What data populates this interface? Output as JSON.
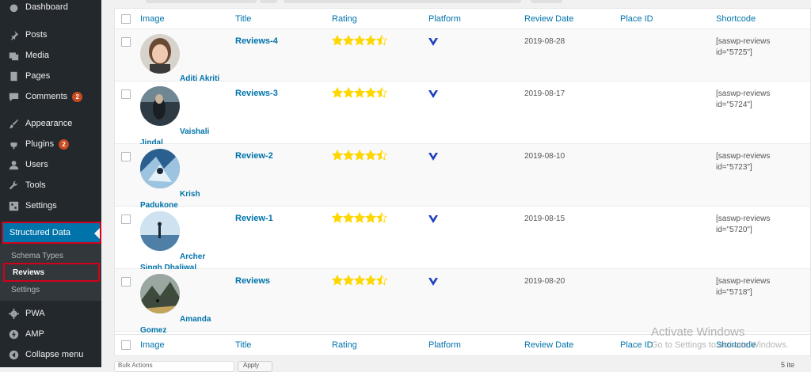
{
  "sidebar": {
    "items": [
      {
        "label": "Dashboard",
        "icon": "dashboard-icon"
      },
      {
        "label": "Posts",
        "icon": "pin-icon"
      },
      {
        "label": "Media",
        "icon": "media-icon"
      },
      {
        "label": "Pages",
        "icon": "pages-icon"
      },
      {
        "label": "Comments",
        "icon": "comment-icon",
        "badge": "2"
      },
      {
        "label": "Appearance",
        "icon": "brush-icon"
      },
      {
        "label": "Plugins",
        "icon": "plug-icon",
        "badge": "2"
      },
      {
        "label": "Users",
        "icon": "user-icon"
      },
      {
        "label": "Tools",
        "icon": "wrench-icon"
      },
      {
        "label": "Settings",
        "icon": "settings-icon"
      }
    ],
    "active": {
      "label": "Structured Data",
      "icon": "pin-icon"
    },
    "submenu": [
      "Schema Types",
      "Reviews",
      "Settings"
    ],
    "lower": [
      {
        "label": "PWA",
        "icon": "gear-icon"
      },
      {
        "label": "AMP",
        "icon": "amp-icon"
      },
      {
        "label": "Collapse menu",
        "icon": "collapse-icon"
      }
    ]
  },
  "table": {
    "columns": [
      "Image",
      "Title",
      "Rating",
      "Platform",
      "Review Date",
      "Place ID",
      "Shortcode"
    ],
    "rows": [
      {
        "name_line1": "Aditi Akriti",
        "name_line2": "",
        "title": "Reviews-4",
        "rating": 4.5,
        "date": "2019-08-28",
        "place_id": "",
        "shortcode_1": "[saswp-reviews",
        "shortcode_2": "id=\"5725\"]"
      },
      {
        "name_line1": "Vaishali",
        "name_line2": "Jindal",
        "title": "Reviews-3",
        "rating": 4.5,
        "date": "2019-08-17",
        "place_id": "",
        "shortcode_1": "[saswp-reviews",
        "shortcode_2": "id=\"5724\"]"
      },
      {
        "name_line1": "Krish",
        "name_line2": "Padukone",
        "title": "Review-2",
        "rating": 4.5,
        "date": "2019-08-10",
        "place_id": "",
        "shortcode_1": "[saswp-reviews",
        "shortcode_2": "id=\"5723\"]"
      },
      {
        "name_line1": "Archer",
        "name_line2": "Singh Dhaliwal",
        "title": "Review-1",
        "rating": 4.5,
        "date": "2019-08-15",
        "place_id": "",
        "shortcode_1": "[saswp-reviews",
        "shortcode_2": "id=\"5720\"]"
      },
      {
        "name_line1": "Amanda",
        "name_line2": "Gomez",
        "title": "Reviews",
        "rating": 4.5,
        "date": "2019-08-20",
        "place_id": "",
        "shortcode_1": "[saswp-reviews",
        "shortcode_2": "id=\"5718\"]"
      }
    ]
  },
  "footer": {
    "bulk_actions": "Bulk Actions",
    "apply": "Apply",
    "items_count": "5 ite"
  },
  "watermark": {
    "line1": "Activate Windows",
    "line2": "Go to Settings to activate Windows."
  },
  "colors": {
    "sidebar_bg": "#23282d",
    "active_bg": "#0073aa",
    "highlight_border": "#d0021b",
    "link": "#0073aa",
    "star": "#ffd700",
    "badge": "#ca4a1f"
  }
}
